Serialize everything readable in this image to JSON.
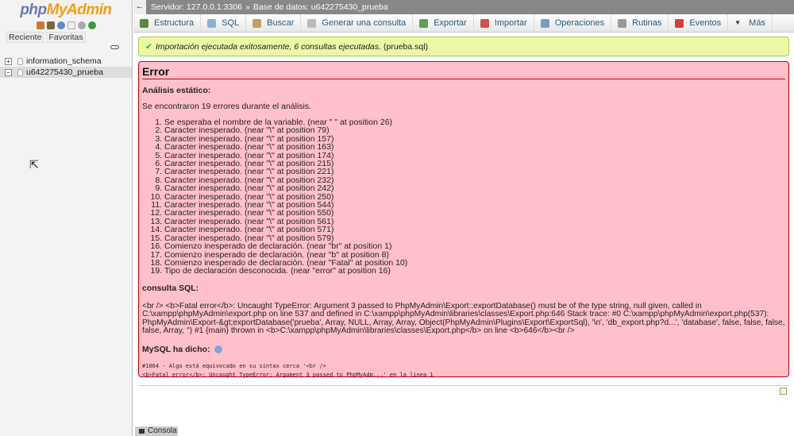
{
  "sidebar": {
    "logo_php": "php",
    "logo_myadmin": "MyAdmin",
    "tabs": [
      "Reciente",
      "Favoritas"
    ],
    "tree": [
      {
        "label": "information_schema"
      },
      {
        "label": "u642275430_prueba"
      }
    ]
  },
  "topbar": {
    "back": "←",
    "server": "Servidor: 127.0.0.1:3306",
    "sep": "»",
    "database": "Base de datos: u642275430_prueba"
  },
  "tabs": [
    {
      "label": "Estructura",
      "color": "#5a8a3c"
    },
    {
      "label": "SQL",
      "color": "#8ab0d8"
    },
    {
      "label": "Buscar",
      "color": "#c0a060"
    },
    {
      "label": "Generar una consulta",
      "color": "#bbb"
    },
    {
      "label": "Exportar",
      "color": "#5a9e5a"
    },
    {
      "label": "Importar",
      "color": "#d05050"
    },
    {
      "label": "Operaciones",
      "color": "#7a9cc8"
    },
    {
      "label": "Rutinas",
      "color": "#999"
    },
    {
      "label": "Eventos",
      "color": "#d04040"
    },
    {
      "label": "Más",
      "color": "transparent"
    }
  ],
  "success": {
    "text": "Importación ejecutada exitosamente, 6 consultas ejecutadas.",
    "file": "(prueba.sql)"
  },
  "error": {
    "title": "Error",
    "static_heading": "Análisis estático:",
    "summary": "Se encontraron 19 errores durante el análisis.",
    "items": [
      "Se esperaba el nombre de la variable. (near \" \" at position 26)",
      "Caracter inesperado. (near \"\\\" at position 79)",
      "Caracter inesperado. (near \"\\\" at position 157)",
      "Caracter inesperado. (near \"\\\" at position 163)",
      "Caracter inesperado. (near \"\\\" at position 174)",
      "Caracter inesperado. (near \"\\\" at position 215)",
      "Caracter inesperado. (near \"\\\" at position 221)",
      "Caracter inesperado. (near \"\\\" at position 232)",
      "Caracter inesperado. (near \"\\\" at position 242)",
      "Caracter inesperado. (near \"\\\" at position 250)",
      "Caracter inesperado. (near \"\\\" at position 544)",
      "Caracter inesperado. (near \"\\\" at position 550)",
      "Caracter inesperado. (near \"\\\" at position 561)",
      "Caracter inesperado. (near \"\\\" at position 571)",
      "Caracter inesperado. (near \"\\\" at position 579)",
      "Comienzo inesperado de declaración. (near \"br\" at position 1)",
      "Comienzo inesperado de declaración. (near \"b\" at position 8)",
      "Comienzo inesperado de declaración. (near \"Fatal\" at position 10)",
      "Tipo de declaración desconocida. (near \"error\" at position 16)"
    ],
    "sql_heading": "consulta SQL:",
    "sql": "<br /> <b>Fatal error</b>: Uncaught TypeError: Argument 3 passed to PhpMyAdmin\\Export::exportDatabase() must be of the type string, null given, called in C:\\xampp\\phpMyAdmin\\export.php on line 537 and defined in C:\\xampp\\phpMyAdmin\\libraries\\classes\\Export.php:646 Stack trace: #0 C:\\xampp\\phpMyAdmin\\export.php(537): PhpMyAdmin\\Export-&gt;exportDatabase('prueba', Array, NULL, Array, Array, Object(PhpMyAdmin\\Plugins\\Export\\ExportSql), '\\n', 'db_export.php?d...', 'database', false, false, false, false, Array, '') #1 {main} thrown in <b>C:\\xampp\\phpMyAdmin\\libraries\\classes\\Export.php</b> on line <b>646</b><br />",
    "mysql_heading": "MySQL ha dicho:",
    "mysql_line1": "#1064 - Algo está equivocado en su sintax cerca '<br />",
    "mysql_line2": "<b>Fatal error</b>:  Uncaught TypeError: Argument 3 passed to PhpMyAdm...' en la linea 1"
  },
  "console": "Consola"
}
